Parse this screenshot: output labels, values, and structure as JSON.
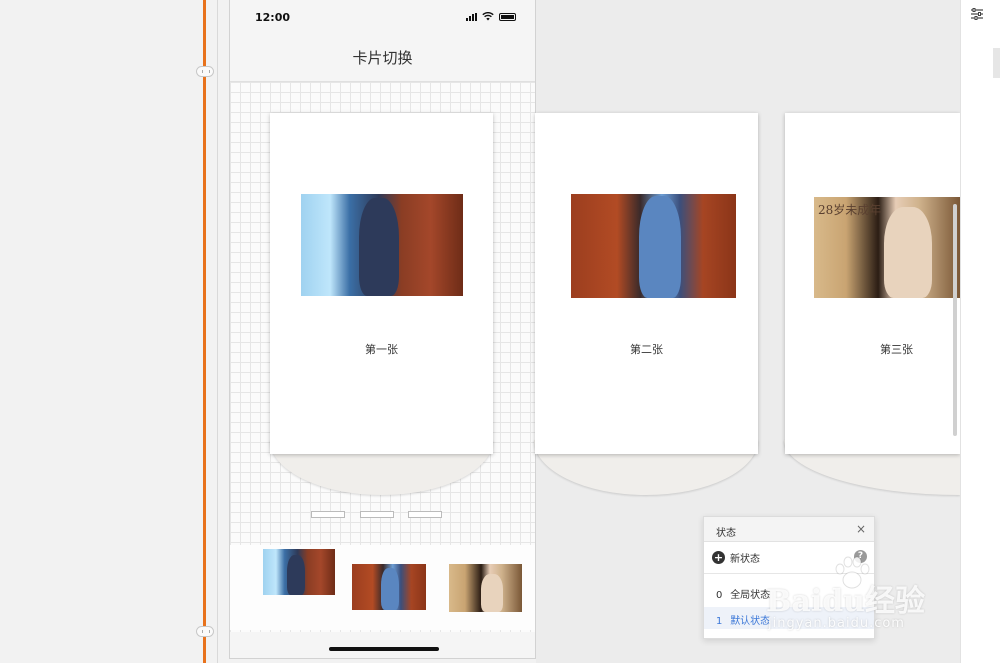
{
  "status_bar": {
    "time": "12:00"
  },
  "nav": {
    "title": "卡片切换"
  },
  "cards": [
    {
      "label": "第一张",
      "photo": "photo-1"
    },
    {
      "label": "第二张",
      "photo": "photo-2"
    },
    {
      "label": "第三张",
      "photo": "photo-3"
    }
  ],
  "photo3_overlay_text": "28岁未成年",
  "pagination": {
    "count": 3
  },
  "thumbnails": [
    "photo-1",
    "photo-2",
    "photo-3"
  ],
  "state_panel": {
    "title": "状态",
    "close_icon": "close-icon",
    "new_state_label": "新状态",
    "help_icon": "?",
    "states": [
      {
        "index": "0",
        "label": "全局状态"
      },
      {
        "index": "1",
        "label": "默认状态",
        "selected": true
      }
    ]
  },
  "right_panel": {
    "icon": "settings-sliders-icon"
  },
  "watermark": {
    "main": "Baidu经验",
    "sub": "jingyan.baidu.com"
  },
  "colors": {
    "ruler_accent": "#e8721c",
    "selected_state": "#3c78d8"
  }
}
